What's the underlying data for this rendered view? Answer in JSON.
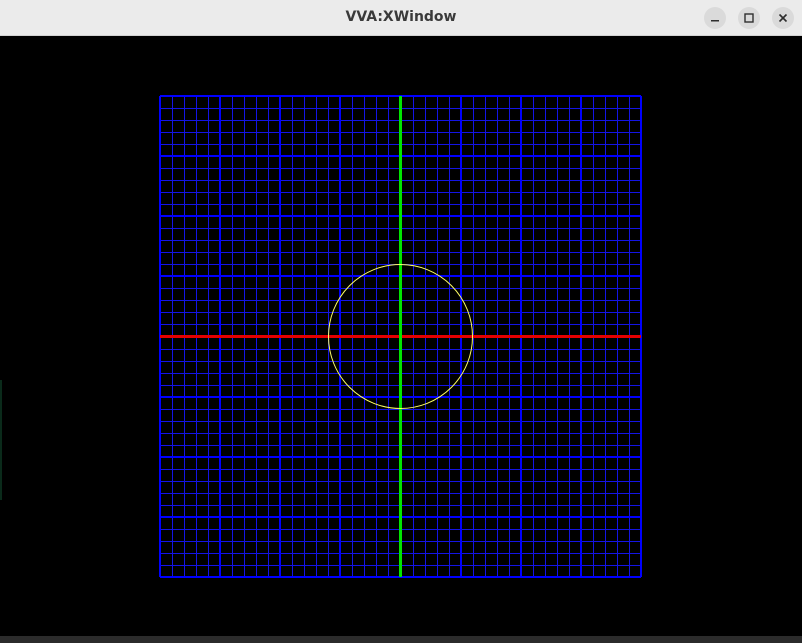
{
  "window": {
    "title": "VVA:XWindow",
    "controls": {
      "minimize": "minimize",
      "maximize": "maximize",
      "close": "close"
    }
  },
  "plot": {
    "background_color": "#000000",
    "minor_grid_color": "#1414e6",
    "major_grid_color": "#0000ff",
    "x_axis_color": "#e60000",
    "y_axis_color": "#00e600",
    "circle_color": "#ffff66",
    "minor_divisions": 40,
    "major_every": 5,
    "axes_shown": true,
    "circle_shown": true
  }
}
